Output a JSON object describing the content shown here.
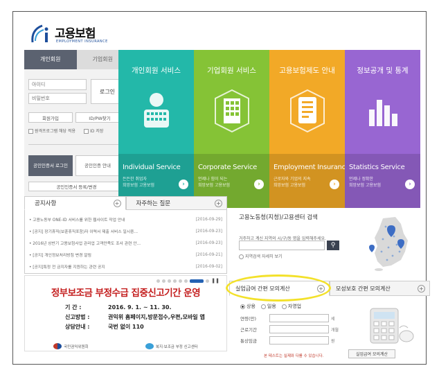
{
  "header": {
    "logo_text": "고용보험",
    "logo_sub": "EMPLOYMENT INSURANCE"
  },
  "login": {
    "tabs": [
      "개인회원",
      "기업회원"
    ],
    "id_placeholder": "아이디",
    "pw_placeholder": "비밀번호",
    "login_button": "로그인",
    "join_button": "회원가입",
    "find_button": "ID/PW찾기",
    "checkbox_1": "원격프로그램 해당 적용",
    "checkbox_2": "ID 저장",
    "cert_login": "공인인증서 로그인",
    "cert_guide": "공인인증 안내",
    "cert_manage": "공인인증서 등록/변경"
  },
  "tiles": [
    {
      "title": "개인회원 서비스",
      "en": "Individual Service",
      "desc1": "든든한 취업자",
      "desc2": "희망보험 고용보험",
      "color": "#23b8a9"
    },
    {
      "title": "기업회원 서비스",
      "en": "Corporate Service",
      "desc1": "언제나 힘이 되는",
      "desc2": "희망보험 고용보험",
      "color": "#85c336"
    },
    {
      "title": "고용보험제도 안내",
      "en": "Employment Insurance",
      "desc1": "근로자와 기업의 지속",
      "desc2": "희망보험 고용보험",
      "color": "#f2a927"
    },
    {
      "title": "정보공개 및 통계",
      "en": "Statistics Service",
      "desc1": "언제나 정확한",
      "desc2": "희망보험 고용보험",
      "color": "#9866d2"
    }
  ],
  "notice": {
    "tabs": [
      "공지사항",
      "자주하는 질문"
    ],
    "items": [
      {
        "text": "• 고용노동부 ONE-ID 서비스를 위한 웹사이트 작업 안내",
        "date": "[2016-09-29]"
      },
      {
        "text": "• [공지] 장기휴직(보훈휴직포함)자 이력서 제출 서비스 일시중...",
        "date": "[2016-09-23]"
      },
      {
        "text": "• 2016년 상반기 고용보험사업 관리업 고객만족도 조사 관련 안...",
        "date": "[2016-09-23]"
      },
      {
        "text": "• [공지] 개인정보처리방침 변경 알림",
        "date": "[2016-09-21]"
      },
      {
        "text": "• [공지]특정 전 금지자를 지원하는 관련 공지",
        "date": "[2016-09-02]"
      }
    ]
  },
  "banner": {
    "title": "정부보조금 부정수급 집중신고기간 운영",
    "period_label": "기    간 :",
    "period_value": "2016. 9. 1. ~ 11. 30.",
    "method_label": "신고방법 :",
    "method_value": "권익위 홈페이지,방문접수,우편,모바일 앱",
    "contact_label": "상담안내 :",
    "contact_value": "국번 없이 110",
    "logo_1": "국민권익위원회",
    "logo_2": "복지·보조금 부정 신고센터"
  },
  "search": {
    "title": "고용노동청(지청)/고용센터 검색",
    "desc": "거주하고 계신 지역의 시/구/동 명을 입력해주세요.",
    "option": "지역검색 자세히 보기"
  },
  "calc": {
    "tabs": [
      "실업급여 간편 모의계산",
      "모성보호 간편 모의계산"
    ],
    "radios": [
      "상용",
      "일용",
      "자영업"
    ],
    "rows": [
      {
        "label": "연령(만)",
        "unit": "세"
      },
      {
        "label": "근로기간",
        "unit": "개월"
      },
      {
        "label": "통상임금",
        "unit": "원"
      }
    ],
    "note": "본 테스트는 실제와 다를 수 있습니다.",
    "button": "실업급여 모의계산"
  }
}
